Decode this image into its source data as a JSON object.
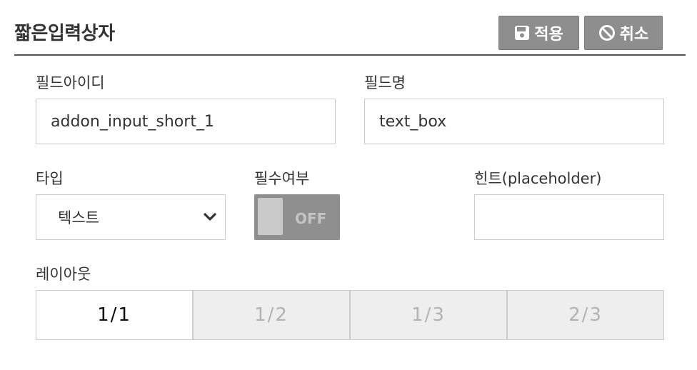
{
  "header": {
    "title": "짧은입력상자",
    "apply_label": "적용",
    "cancel_label": "취소"
  },
  "fields": {
    "field_id": {
      "label": "필드아이디",
      "value": "addon_input_short_1"
    },
    "field_name": {
      "label": "필드명",
      "value": "text_box"
    },
    "type": {
      "label": "타입",
      "selected": "텍스트"
    },
    "required": {
      "label": "필수여부",
      "state": "OFF"
    },
    "hint": {
      "label": "힌트(placeholder)",
      "value": ""
    }
  },
  "layout": {
    "label": "레이아웃",
    "options": [
      "1/1",
      "1/2",
      "1/3",
      "2/3"
    ],
    "selected": "1/1"
  },
  "colors": {
    "button_bg": "#8e8e8e",
    "toggle_bg": "#8f8f8f",
    "inactive_segment_bg": "#eeeeee"
  }
}
